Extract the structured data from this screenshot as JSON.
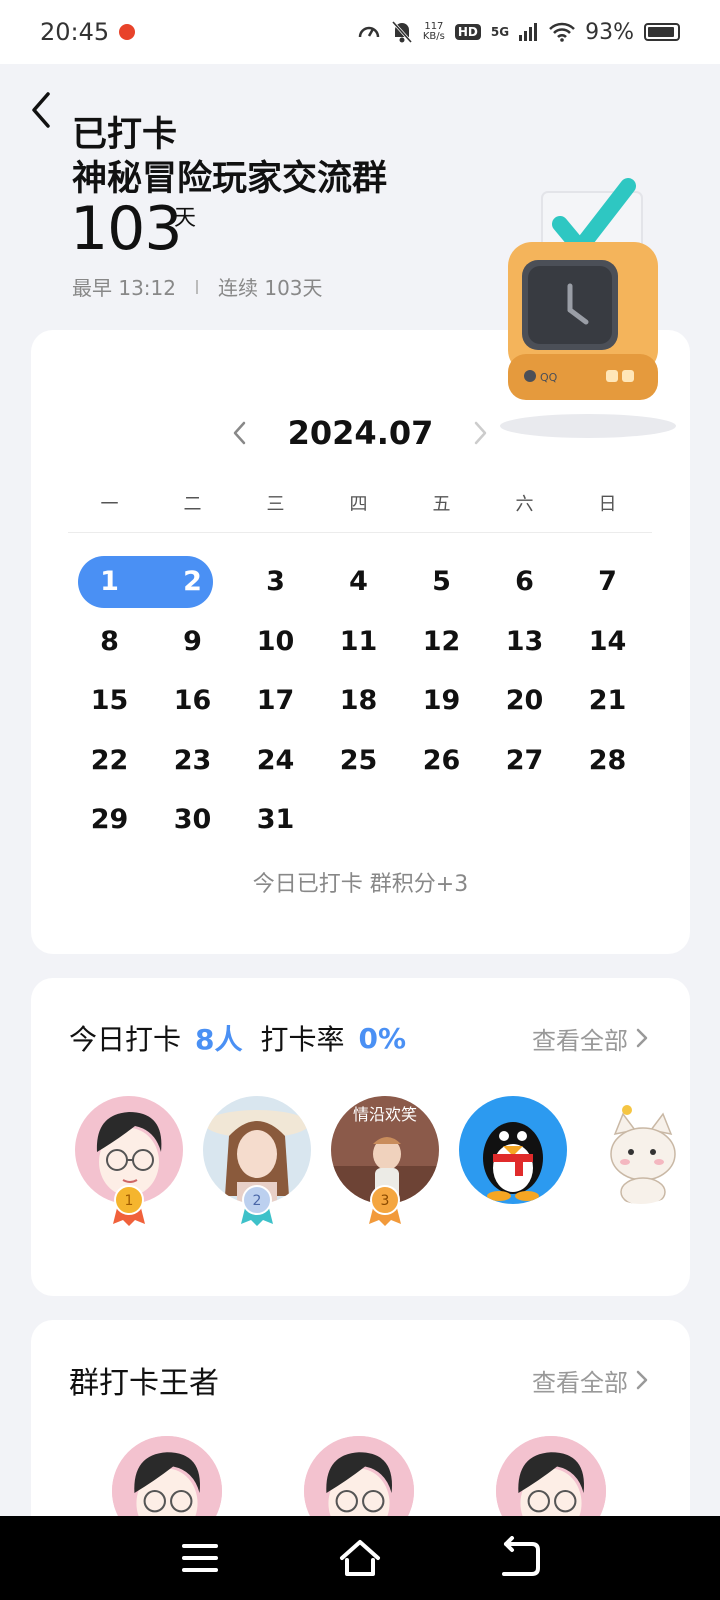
{
  "status": {
    "time": "20:45",
    "net_speed_value": "117",
    "net_speed_unit": "KB/s",
    "hd": "HD",
    "network": "5G",
    "battery": "93%"
  },
  "hero": {
    "status_line": "已打卡",
    "group_name": "神秘冒险玩家交流群",
    "days_value": "103",
    "days_unit": "天",
    "earliest": "最早 13:12",
    "streak": "连续 103天"
  },
  "calendar": {
    "month": "2024.07",
    "weekdays": [
      "一",
      "二",
      "三",
      "四",
      "五",
      "六",
      "日"
    ],
    "days": [
      "1",
      "2",
      "3",
      "4",
      "5",
      "6",
      "7",
      "8",
      "9",
      "10",
      "11",
      "12",
      "13",
      "14",
      "15",
      "16",
      "17",
      "18",
      "19",
      "20",
      "21",
      "22",
      "23",
      "24",
      "25",
      "26",
      "27",
      "28",
      "29",
      "30",
      "31"
    ],
    "checked_days": [
      "1",
      "2"
    ],
    "today_note": "今日已打卡  群积分+3"
  },
  "today_checkin": {
    "label": "今日打卡",
    "count": "8人",
    "rate_label": "打卡率",
    "rate_value": "0%",
    "view_all": "查看全部",
    "avatar_overlay_text": "情沿欢笑",
    "ranks": [
      "1",
      "2",
      "3"
    ]
  },
  "kings": {
    "title": "群打卡王者",
    "view_all": "查看全部"
  },
  "colors": {
    "accent": "#4a90f4",
    "background": "#f2f3f7",
    "card": "#ffffff",
    "muted_text": "#888888"
  }
}
